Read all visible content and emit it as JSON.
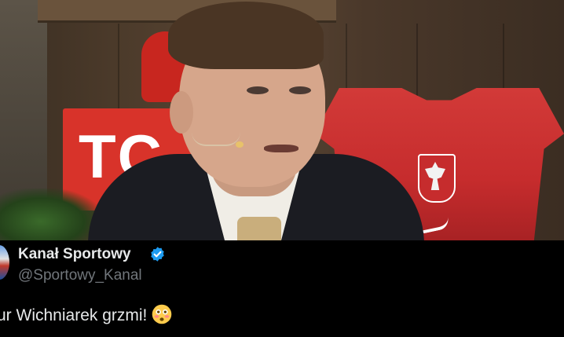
{
  "media": {
    "photo_alt": "",
    "background_sign_text": "TC"
  },
  "tweet": {
    "display_name": "Kanał Sportowy",
    "verified": true,
    "handle": "@Sportowy_Kanal",
    "text": "ur Wichniarek grzmi!",
    "emoji": "flushed-face-emoji"
  },
  "colors": {
    "background": "#000000",
    "name_text": "#e7e9ea",
    "handle_text": "#71767b",
    "verified_badge": "#1d9bf0",
    "sign_red": "#d8332a",
    "jersey_red": "#c62c2d"
  }
}
